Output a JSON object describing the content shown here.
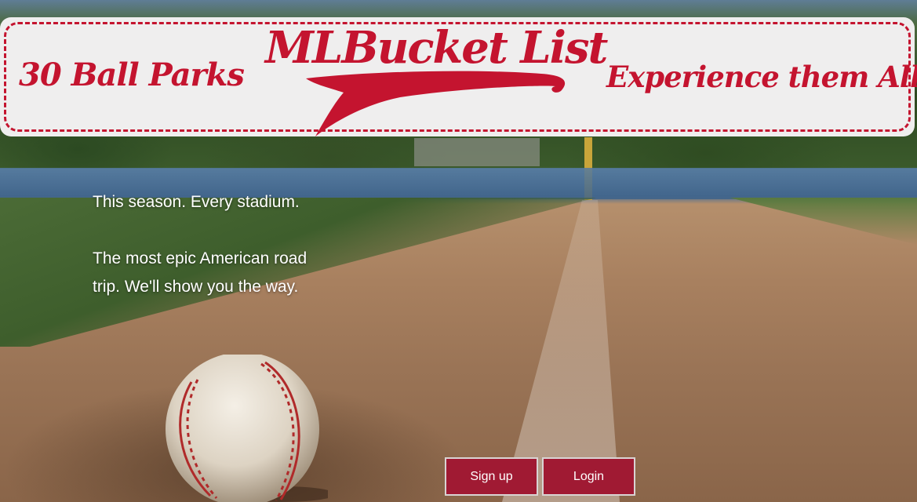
{
  "header": {
    "tagline_left": "30 Ball Parks",
    "logo_text": "MLBucket List",
    "tagline_right": "Experience them All."
  },
  "hero": {
    "line1": "This season. Every stadium.",
    "line2": "The most epic American road trip. We'll show you the way."
  },
  "buttons": {
    "signup_label": "Sign up",
    "login_label": "Login"
  },
  "colors": {
    "brand_red": "#c4142f",
    "button_bg": "#a01a33",
    "banner_bg": "#efeeee"
  }
}
